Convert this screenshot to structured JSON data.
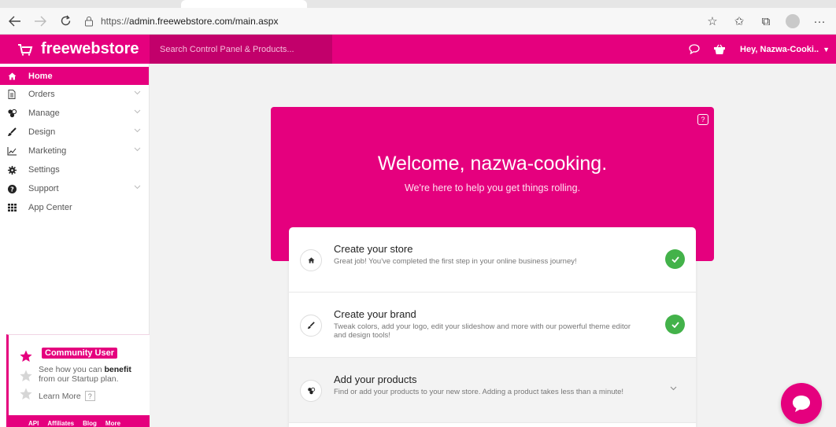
{
  "browser": {
    "url_protocol": "https://",
    "url_host": "admin.freewebstore.com/main.aspx"
  },
  "header": {
    "brand": "freewebstore",
    "search_placeholder": "Search Control Panel & Products...",
    "user_greeting": "Hey, Nazwa-Cooki..",
    "accent_color": "#e5007e"
  },
  "sidebar": {
    "items": [
      {
        "label": "Home",
        "icon": "home-icon"
      },
      {
        "label": "Orders",
        "icon": "document-icon"
      },
      {
        "label": "Manage",
        "icon": "cubes-icon"
      },
      {
        "label": "Design",
        "icon": "brush-icon"
      },
      {
        "label": "Marketing",
        "icon": "chart-line-icon"
      },
      {
        "label": "Settings",
        "icon": "gear-icon"
      },
      {
        "label": "Support",
        "icon": "question-icon"
      },
      {
        "label": "App Center",
        "icon": "grid-icon"
      }
    ],
    "community": {
      "badge": "Community User",
      "text_pre": "See how you can ",
      "text_bold": "benefit",
      "text_post": " from our Startup plan.",
      "learn_more": "Learn More",
      "help": "?"
    },
    "footer_links": [
      "API",
      "Affiliates",
      "Blog",
      "More"
    ]
  },
  "welcome": {
    "title": "Welcome, nazwa-cooking.",
    "subtitle": "We're here to help you get things rolling.",
    "help": "?"
  },
  "steps": [
    {
      "title": "Create your store",
      "desc": "Great job! You've completed the first step in your online business journey!",
      "status": "complete",
      "icon": "home-icon"
    },
    {
      "title": "Create your brand",
      "desc": "Tweak colors, add your logo, edit your slideshow and more with our powerful theme editor and design tools!",
      "status": "complete",
      "icon": "brush-icon"
    },
    {
      "title": "Add your products",
      "desc": "Find or add your products to your new store. Adding a product takes less than a minute!",
      "status": "expandable",
      "icon": "cubes-icon"
    }
  ]
}
